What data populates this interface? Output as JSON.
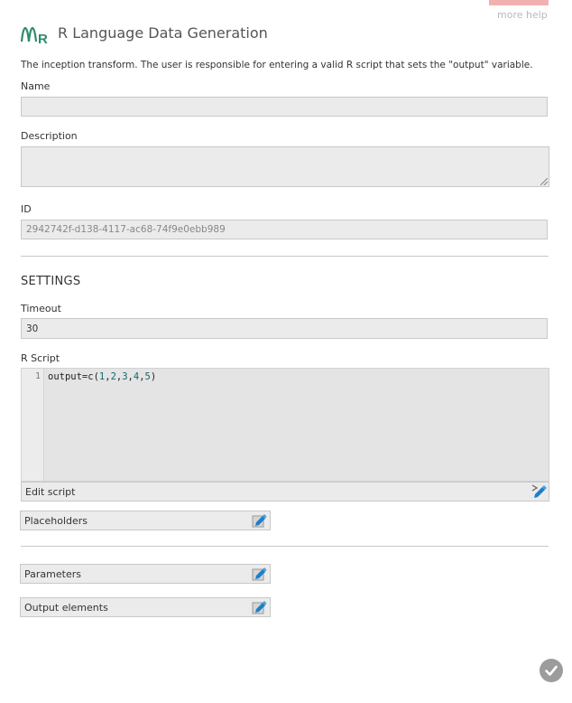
{
  "header": {
    "title": "R Language Data Generation",
    "more_help": "more help",
    "logo_icon": "r-language-logo-icon",
    "logo_color": "#2e8b6e"
  },
  "intro": "The inception transform. The user is responsible for entering a valid R script that sets the \"output\" variable.",
  "fields": {
    "name": {
      "label": "Name",
      "value": ""
    },
    "description": {
      "label": "Description",
      "value": ""
    },
    "id": {
      "label": "ID",
      "value": "2942742f-d138-4117-ac68-74f9e0ebb989"
    }
  },
  "settings": {
    "title": "SETTINGS",
    "timeout": {
      "label": "Timeout",
      "value": "30"
    },
    "r_script": {
      "label": "R Script",
      "line_number": "1",
      "code": "output=c(1,2,3,4,5)",
      "edit_label": "Edit script"
    },
    "placeholders_label": "Placeholders"
  },
  "sections": {
    "parameters_label": "Parameters",
    "output_elements_label": "Output elements"
  },
  "icons": {
    "edit_script": "edit-script-icon",
    "edit": "edit-pencil-icon",
    "confirm": "checkmark-icon"
  },
  "colors": {
    "accent": "#1e7fc8",
    "more_help_bar": "#f2b1b1",
    "field_bg": "#ebebeb"
  }
}
